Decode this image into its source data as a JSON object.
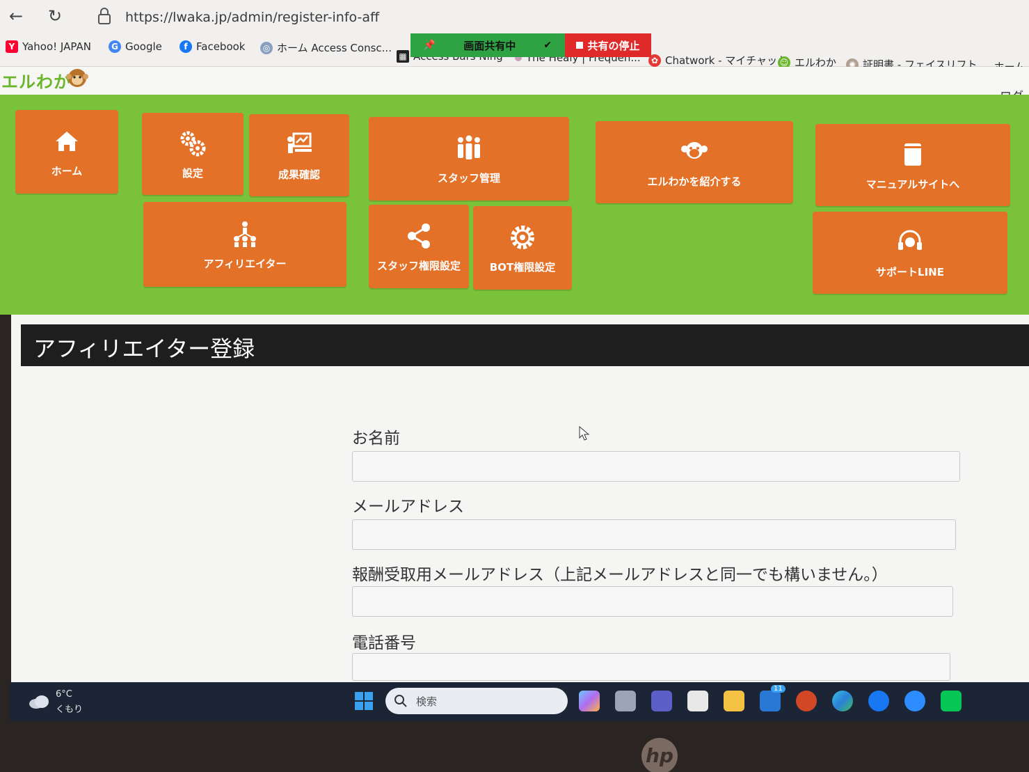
{
  "browser": {
    "url": "https://lwaka.jp/admin/register-info-aff",
    "bookmarks": [
      {
        "label": "Yahoo! JAPAN",
        "icon": "yahoo-icon"
      },
      {
        "label": "Google",
        "icon": "google-icon"
      },
      {
        "label": "Facebook",
        "icon": "facebook-icon"
      },
      {
        "label": "ホーム Access Consc...",
        "icon": "globe-icon"
      },
      {
        "label": "Access Bars Ning",
        "icon": "qr-icon"
      },
      {
        "label": "The Healy | Frequen...",
        "icon": "healy-icon"
      },
      {
        "label": "Chatwork - マイチャット",
        "icon": "chatwork-icon"
      },
      {
        "label": "エルわか",
        "icon": "erwaka-icon"
      },
      {
        "label": "証明書 - フェイスリフト...",
        "icon": "cert-icon"
      },
      {
        "label": "ホーム -",
        "icon": "qr-icon"
      }
    ],
    "share": {
      "status_label": "画面共有中",
      "stop_label": "共有の停止",
      "status_color": "#2fa344",
      "stop_color": "#e02a2a"
    }
  },
  "site": {
    "logo_text": "エルわか",
    "logout_label": "ログ",
    "accent_green": "#7bc23b",
    "tile_orange": "#e37127"
  },
  "menu": {
    "home": {
      "label": "ホーム",
      "icon": "home-icon"
    },
    "settings": {
      "label": "設定",
      "icon": "gears-icon"
    },
    "results": {
      "label": "成果確認",
      "icon": "presentation-icon"
    },
    "staff": {
      "label": "スタッフ管理",
      "icon": "people-icon"
    },
    "introduce": {
      "label": "エルわかを紹介する",
      "icon": "monkey-icon"
    },
    "manual": {
      "label": "マニュアルサイトへ",
      "icon": "book-icon"
    },
    "affiliator": {
      "label": "アフィリエイター",
      "icon": "org-chart-icon"
    },
    "staff_perm": {
      "label": "スタッフ権限設定",
      "icon": "share-icon"
    },
    "bot_perm": {
      "label": "BOT権限設定",
      "icon": "gear-icon"
    },
    "support": {
      "label": "サポートLINE",
      "icon": "headset-icon"
    }
  },
  "page": {
    "title": "アフィリエイター登録",
    "form": {
      "name_label": "お名前",
      "name_value": "",
      "email_label": "メールアドレス",
      "email_value": "",
      "payout_email_label": "報酬受取用メールアドレス（上記メールアドレスと同一でも構いません。）",
      "payout_email_value": "",
      "phone_label": "電話番号",
      "phone_value": ""
    }
  },
  "taskbar": {
    "weather_temp": "6°C",
    "weather_condition": "くもり",
    "search_placeholder": "検索",
    "apps": [
      "copilot-icon",
      "task-view-icon",
      "teams-icon",
      "store-icon",
      "file-explorer-icon",
      "mail-icon",
      "powerpoint-icon",
      "edge-icon",
      "facebook-icon",
      "zoom-icon",
      "line-icon"
    ],
    "mail_badge": "11"
  },
  "device": {
    "brand": "hp"
  }
}
